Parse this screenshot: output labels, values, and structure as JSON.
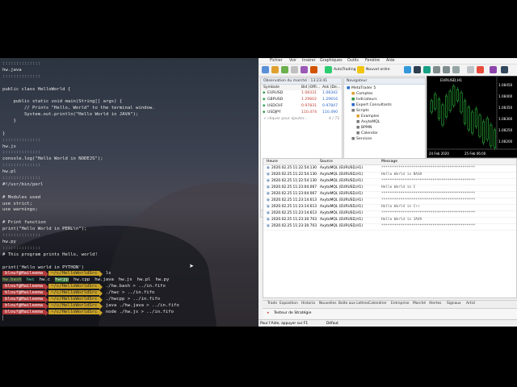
{
  "terminal": {
    "lines": [
      {
        "t": "::::::::::::::",
        "c": "c-dim"
      },
      {
        "t": "hw.java",
        "c": ""
      },
      {
        "t": "::::::::::::::",
        "c": "c-dim"
      },
      {
        "t": "",
        "c": ""
      },
      {
        "t": "public class HelloWorld {",
        "c": ""
      },
      {
        "t": "",
        "c": ""
      },
      {
        "t": "    public static void main(String[] args) {",
        "c": ""
      },
      {
        "t": "        // Prints \"Hello, World\" to the terminal window.",
        "c": ""
      },
      {
        "t": "        System.out.println(\"Hello World in JAVA\");",
        "c": ""
      },
      {
        "t": "    }",
        "c": ""
      },
      {
        "t": "",
        "c": ""
      },
      {
        "t": "}",
        "c": ""
      },
      {
        "t": "::::::::::::::",
        "c": "c-dim"
      },
      {
        "t": "hw.js",
        "c": ""
      },
      {
        "t": "::::::::::::::",
        "c": "c-dim"
      },
      {
        "t": "console.log(\"Hello World in NODEJS\");",
        "c": ""
      },
      {
        "t": "::::::::::::::",
        "c": "c-dim"
      },
      {
        "t": "hw.pl",
        "c": ""
      },
      {
        "t": "::::::::::::::",
        "c": "c-dim"
      },
      {
        "t": "#!/usr/bin/perl",
        "c": ""
      },
      {
        "t": "",
        "c": ""
      },
      {
        "t": "# Modules used",
        "c": ""
      },
      {
        "t": "use strict;",
        "c": ""
      },
      {
        "t": "use warnings;",
        "c": ""
      },
      {
        "t": "",
        "c": ""
      },
      {
        "t": "# Print function",
        "c": ""
      },
      {
        "t": "print(\"Hello World in PERL\\n\");",
        "c": ""
      },
      {
        "t": "::::::::::::::",
        "c": "c-dim"
      },
      {
        "t": "hw.py",
        "c": ""
      },
      {
        "t": "::::::::::::::",
        "c": "c-dim"
      },
      {
        "t": "# This program prints Hello, world!",
        "c": ""
      },
      {
        "t": "",
        "c": ""
      },
      {
        "t": "print('Hello world in PYTHON')",
        "c": ""
      }
    ],
    "prompt_user": "blouf@Haileema",
    "prompt_path": "~/c/HelloWorldSrc",
    "commands": [
      "ls",
      "./hw.bash > ../in.fifo",
      "./hwc > ../in.fifo",
      "./hwcpp > ../in.fifo",
      "java ./hw.java > ../in.fifo",
      "node ./hw.js > ../in.fifo"
    ],
    "ls_output": [
      "hw.bash",
      "hwc",
      "hw.c",
      "hwcpp",
      "hw.cpp",
      "hw.java",
      "hw.js",
      "hw.pl",
      "hw.py"
    ]
  },
  "mt5": {
    "menu": [
      "Fichier",
      "Voir",
      "Insérer",
      "Graphiques",
      "Outils",
      "Fenêtre",
      "Aide"
    ],
    "toolbar": {
      "autotrading": "AutoTrading",
      "new_order": "Nouvel ordre"
    },
    "market_watch": {
      "title": "Observation du marché : 13:23:41",
      "columns": [
        "Symbole",
        "Bid (Offr...",
        "Ask (De..."
      ],
      "rows": [
        {
          "symbol": "EURUSD",
          "bid": "1.08331",
          "ask": "1.08342"
        },
        {
          "symbol": "GBPUSD",
          "bid": "1.29602",
          "ask": "1.29616"
        },
        {
          "symbol": "USDCHF",
          "bid": "0.97831",
          "ask": "0.97847"
        },
        {
          "symbol": "USDJPY",
          "bid": "110.474",
          "ask": "110.490"
        }
      ],
      "add_placeholder": "+ cliquer pour ajouter...",
      "count": "4 / 72",
      "tabs": [
        "Symboles",
        "Détails",
        "Trading",
        "Tiques"
      ]
    },
    "navigator": {
      "title": "Navigateur",
      "items": [
        {
          "label": "MetaTrader 5",
          "indent": 0
        },
        {
          "label": "Comptes",
          "indent": 1
        },
        {
          "label": "Indicateurs",
          "indent": 1
        },
        {
          "label": "Expert Consultants",
          "indent": 1
        },
        {
          "label": "Scripts",
          "indent": 1
        },
        {
          "label": "Examples",
          "indent": 2
        },
        {
          "label": "AxytoMQL",
          "indent": 2
        },
        {
          "label": "BPMN",
          "indent": 2
        },
        {
          "label": "Calendar",
          "indent": 2
        },
        {
          "label": "Services",
          "indent": 1
        }
      ],
      "tabs": [
        "Général",
        "Favoris"
      ]
    },
    "chart": {
      "title": "EURUSD,H1",
      "prices": [
        "1.08450",
        "1.08400",
        "1.08350",
        "1.08300",
        "1.08250",
        "1.08200"
      ],
      "dates": [
        "24 Feb 2020",
        "25 Feb 06:00"
      ]
    },
    "journal": {
      "columns": [
        "Heure",
        "Source",
        "Message"
      ],
      "rows": [
        {
          "time": "2020.02.25 11:22:54.130",
          "source": "AxytoMQL (EURUSD,H1)",
          "msg": "********************************************"
        },
        {
          "time": "2020.02.25 11:22:54.130",
          "source": "AxytoMQL (EURUSD,H1)",
          "msg": "Hello World in BASH"
        },
        {
          "time": "2020.02.25 11:22:54.130",
          "source": "AxytoMQL (EURUSD,H1)",
          "msg": "********************************************"
        },
        {
          "time": "2020.02.25 11:23:04.067",
          "source": "AxytoMQL (EURUSD,H1)",
          "msg": "Hello World in C"
        },
        {
          "time": "2020.02.25 11:23:04.067",
          "source": "AxytoMQL (EURUSD,H1)",
          "msg": "********************************************"
        },
        {
          "time": "2020.02.25 11:23:14.613",
          "source": "AxytoMQL (EURUSD,H1)",
          "msg": "********************************************"
        },
        {
          "time": "2020.02.25 11:23:14.613",
          "source": "AxytoMQL (EURUSD,H1)",
          "msg": "Hello World in C++"
        },
        {
          "time": "2020.02.25 11:23:14.613",
          "source": "AxytoMQL (EURUSD,H1)",
          "msg": "********************************************"
        },
        {
          "time": "2020.02.25 11:23:30.703",
          "source": "AxytoMQL (EURUSD,H1)",
          "msg": "Hello World in JAVA"
        },
        {
          "time": "2020.02.25 11:23:30.703",
          "source": "AxytoMQL (EURUSD,H1)",
          "msg": "********************************************"
        }
      ]
    },
    "bottom_tabs": [
      "Trade",
      "Exposition",
      "Historia",
      "Nouvelles",
      "Boîte aux Lettres",
      "Calendrier",
      "Entreprise",
      "Marché",
      "Alertes",
      "Signaux",
      "Articl"
    ],
    "strategy_tester": "Testeur de Stratégie",
    "status": {
      "help": "Pour l'Aide, appuyer sur F1",
      "profile": "Défaut"
    }
  }
}
